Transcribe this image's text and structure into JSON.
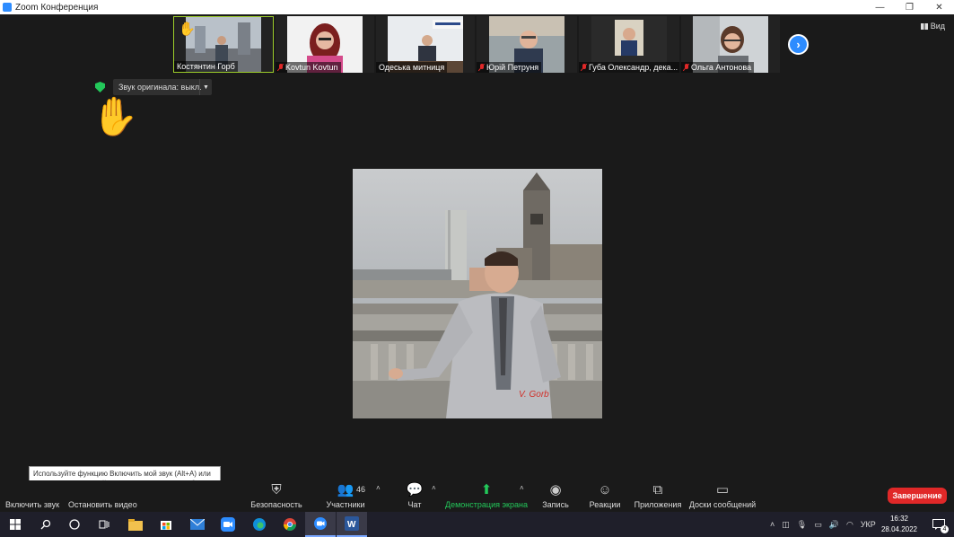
{
  "window": {
    "title": "Zoom Конференция"
  },
  "view": {
    "label": "Вид"
  },
  "participants": [
    {
      "name": "Костянтин Горб",
      "hand_raised": true,
      "muted": false
    },
    {
      "name": "Kovtun Kovtun",
      "hand_raised": false,
      "muted": true
    },
    {
      "name": "Одеська митниця",
      "hand_raised": false,
      "muted": false
    },
    {
      "name": "Юрій Петруня",
      "hand_raised": false,
      "muted": true
    },
    {
      "name": "Губа Олександр, дека...",
      "hand_raised": false,
      "muted": true
    },
    {
      "name": "Ольга Антонова",
      "hand_raised": false,
      "muted": true
    }
  ],
  "original_sound": {
    "label": "Звук оригинала: выкл."
  },
  "main_video": {
    "watermark": "V. Gorb"
  },
  "tooltip": {
    "text": "Используйте функцию Включить мой звук (Alt+A) или нажмите и удерживайте клавишу ПРОБЕЛ, чтобы временно включить звук."
  },
  "toolbar": {
    "unmute": "Включить звук",
    "stop_video": "Остановить видео",
    "security": "Безопасность",
    "participants": "Участники",
    "participants_count": "46",
    "chat": "Чат",
    "share_screen": "Демонстрация экрана",
    "record": "Запись",
    "reactions": "Реакции",
    "apps": "Приложения",
    "whiteboards": "Доски сообщений",
    "end": "Завершение"
  },
  "taskbar": {
    "language": "УКР",
    "time": "16:32",
    "date": "28.04.2022",
    "notifications": "4"
  },
  "colors": {
    "accent": "#2d8cff",
    "end": "#e02828",
    "share": "#23c85a",
    "hand": "#f4c000"
  }
}
